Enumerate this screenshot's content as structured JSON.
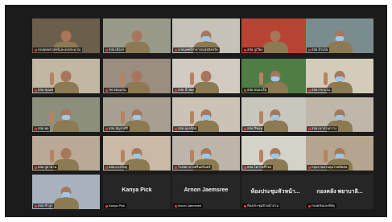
{
  "meeting": {
    "participants": [
      {
        "label": "กองยุทธศาสตร์และงบประมาณ",
        "scene": "#6b5e4a",
        "active": true
      },
      {
        "label": "สสอ.เมืองฯ",
        "scene": "#9a9a8a"
      },
      {
        "label": "นายแพทย์สาธารณสุขจังหวัด",
        "scene": "#c7c2b8",
        "mask": true
      },
      {
        "label": "สสอ.ภูเวียง",
        "scene": "#b74433"
      },
      {
        "label": "สสอ.บ้านไผ่",
        "scene": "#7b8c8f",
        "mask": true
      },
      {
        "label": "สสอ.ชุมแพ",
        "scene": "#c1b7a2",
        "arm": true
      },
      {
        "label": "รพ.ขอนแก่น",
        "scene": "#9b8e80",
        "arm": true
      },
      {
        "label": "สสอ.น้ำพอง",
        "scene": "#d1cbc2",
        "arm": true
      },
      {
        "label": "สสอ.หนองเรือ",
        "scene": "#4f7d45",
        "arm": true,
        "mask": true
      },
      {
        "label": "สสอ.กระนวน",
        "scene": "#d4ccbb",
        "arm": true,
        "mask": true
      },
      {
        "label": "สสอ.พล",
        "scene": "#8b8f7c",
        "arm": true,
        "mask": true
      },
      {
        "label": "สสอ.มัญจาคีรี",
        "scene": "#a79f92",
        "arm": true,
        "mask": true
      },
      {
        "label": "สสอ.อุบลรัตน์",
        "scene": "#cbc3b5",
        "arm": true,
        "mask": true
      },
      {
        "label": "สสอ.สีชมพู",
        "scene": "#c9c6be",
        "arm": true,
        "mask": true
      },
      {
        "label": "สสอ.เขาสวนกวาง",
        "scene": "#bfb8aa",
        "mask": true
      },
      {
        "label": "สสอ.ภูผาม่าน",
        "scene": "#b9a996",
        "arm": true
      },
      {
        "label": "สสอ.แวงใหญ่",
        "scene": "#c9b9a6",
        "arm": true,
        "mask": true
      },
      {
        "label": "โรงพยาบาลศรีนครินทร์",
        "scene": "#bdb5a9",
        "arm": true,
        "mask": true
      },
      {
        "label": "สสอ.โคกโพธิ์ไชย",
        "scene": "#d5d2ca",
        "arm": true,
        "mask": true
      },
      {
        "label": "กลุ่มงานควบคุมโรคติดต่อ",
        "scene": "#b5a590",
        "arm": true,
        "mask": true
      },
      {
        "label": "สสอ.ซำสูง",
        "scene": "#a8b2bf",
        "mask": true
      },
      {
        "label": "Kanya Pick",
        "display": "Kanya Pick",
        "nameOnly": true
      },
      {
        "label": "Arnon Jaemsree",
        "display": "Arnon Jaemsree",
        "nameOnly": true
      },
      {
        "label": "ห้องประชุมหัวหน้าส่วน",
        "display": "ห้องประชุมหัวหน้า...",
        "nameOnly": true
      },
      {
        "label": "กองคลังและพัสดุ",
        "display": "กองคลัง พยาบาลิ...",
        "nameOnly": true
      }
    ]
  }
}
